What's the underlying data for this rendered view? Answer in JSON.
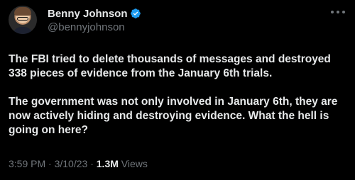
{
  "author": {
    "display_name": "Benny Johnson",
    "handle": "@bennyjohnson",
    "verified": true,
    "verified_color": "#1d9bf0",
    "avatar_icon": "profile-photo"
  },
  "tweet": {
    "paragraphs": [
      "The FBI tried to delete thousands of messages and destroyed 338 pieces of evidence from the January 6th trials.",
      "The government was not only involved in January 6th, they are now actively hiding and destroying evidence. What the hell is going on here?"
    ]
  },
  "meta": {
    "time": "3:59 PM",
    "separator": "·",
    "date": "3/10/23",
    "views_count": "1.3M",
    "views_label": "Views"
  },
  "colors": {
    "background": "#000000",
    "text_primary": "#e7e9ea",
    "text_secondary": "#71767b"
  }
}
